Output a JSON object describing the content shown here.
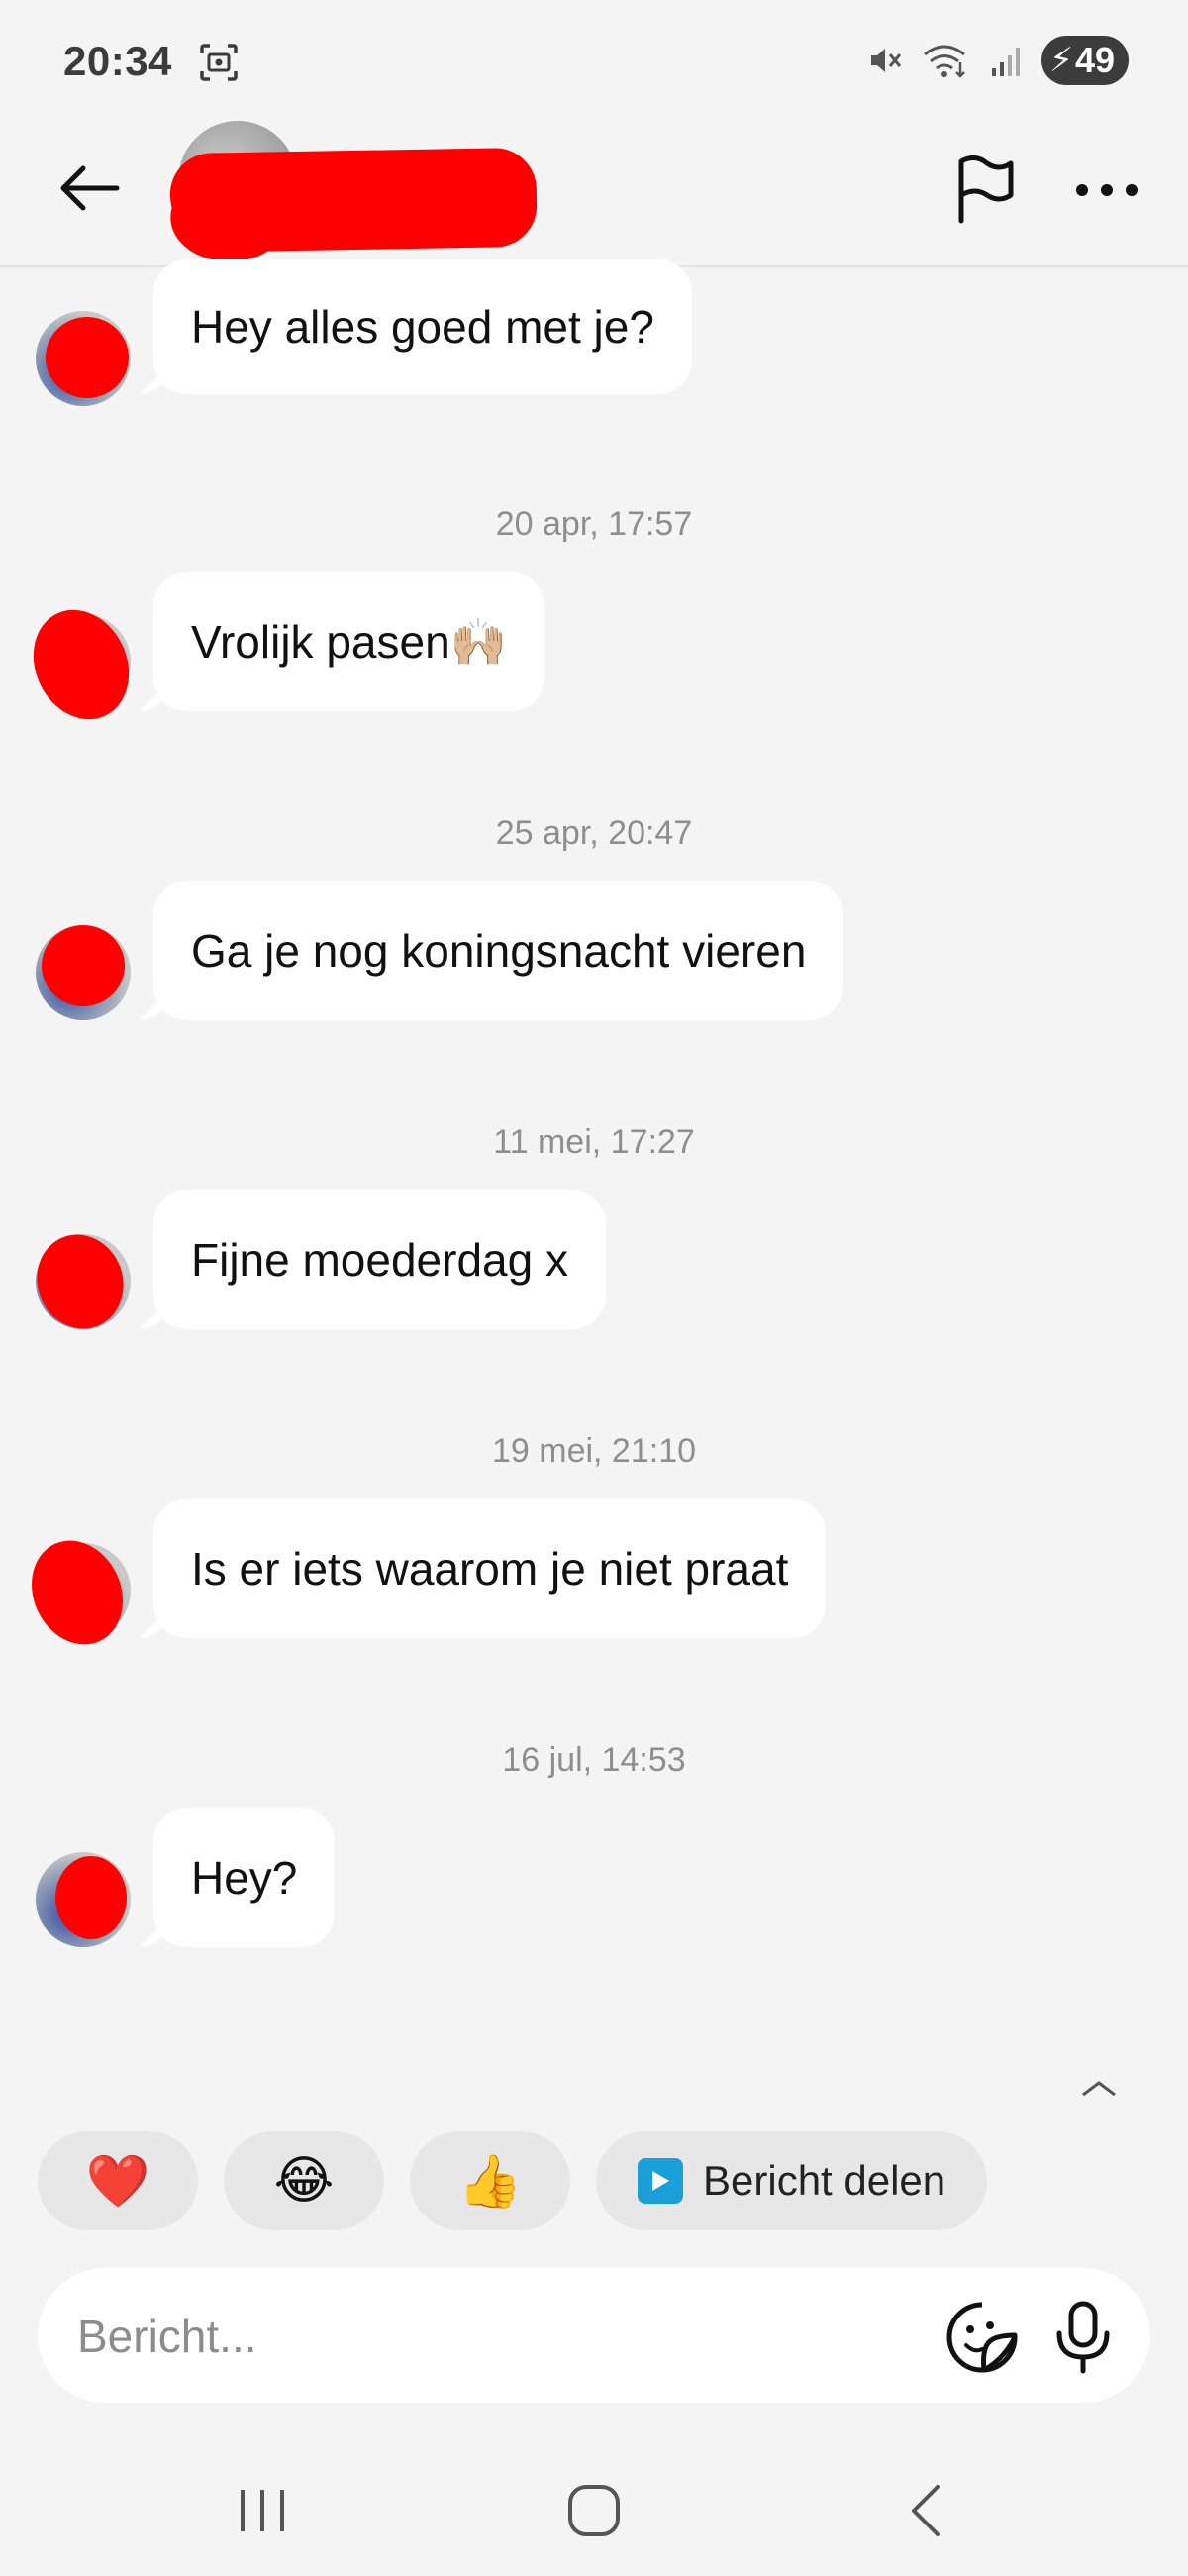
{
  "status_bar": {
    "time": "20:34",
    "battery": "49"
  },
  "header": {
    "back_icon": "arrow-left-icon",
    "report_icon": "flag-icon",
    "more_icon": "more-horizontal-icon"
  },
  "messages": [
    {
      "timestamp": "",
      "text": "Hey alles goed met je?"
    },
    {
      "timestamp": "20 apr, 17:57",
      "text": "Vrolijk pasen🙌🏼"
    },
    {
      "timestamp": "25 apr, 20:47",
      "text": "Ga je nog koningsnacht vieren"
    },
    {
      "timestamp": "11 mei, 17:27",
      "text": "Fijne moederdag x"
    },
    {
      "timestamp": "19 mei, 21:10",
      "text": "Is er iets waarom je niet praat"
    },
    {
      "timestamp": "16 jul, 14:53",
      "text": "Hey?"
    }
  ],
  "quick_reactions": {
    "heart": "❤️",
    "laugh": "😂",
    "thumbs_up": "👍",
    "share_label": "Bericht delen"
  },
  "composer": {
    "placeholder": "Bericht..."
  },
  "colors": {
    "background": "#f4f4f4",
    "bubble": "#ffffff",
    "redaction": "#ff0000",
    "share_icon": "#1a9fd8"
  }
}
